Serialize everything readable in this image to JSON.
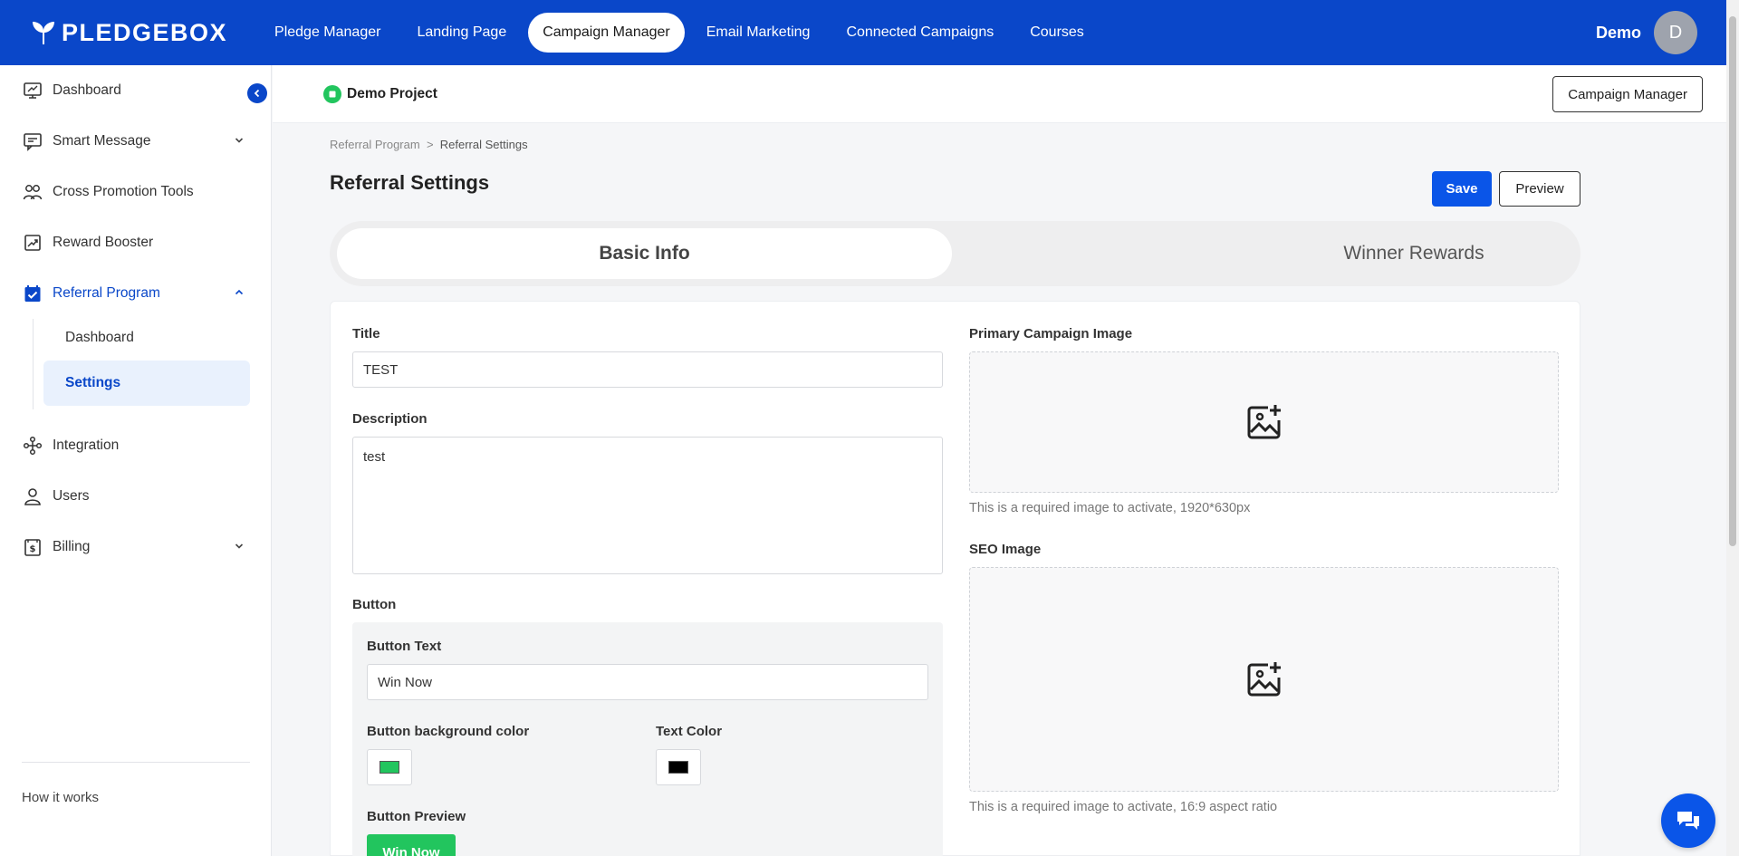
{
  "brand": {
    "name": "PLEDGEBOX"
  },
  "topnav": {
    "items": [
      "Pledge Manager",
      "Landing Page",
      "Campaign Manager",
      "Email Marketing",
      "Connected Campaigns",
      "Courses"
    ],
    "active": "Campaign Manager"
  },
  "user": {
    "name": "Demo",
    "initial": "D"
  },
  "sidebar": {
    "items": [
      {
        "label": "Dashboard",
        "icon": "dashboard-icon"
      },
      {
        "label": "Smart Message",
        "icon": "message-icon"
      },
      {
        "label": "Cross Promotion Tools",
        "icon": "people-icon"
      },
      {
        "label": "Reward Booster",
        "icon": "chart-up-icon"
      },
      {
        "label": "Referral Program",
        "icon": "calendar-check-icon"
      },
      {
        "label": "Integration",
        "icon": "integration-icon"
      },
      {
        "label": "Users",
        "icon": "user-icon"
      },
      {
        "label": "Billing",
        "icon": "billing-icon"
      }
    ],
    "sub_items": [
      "Dashboard",
      "Settings"
    ],
    "footer_link": "How it works"
  },
  "project": {
    "name": "Demo Project",
    "campaign_manager_button": "Campaign Manager"
  },
  "breadcrumb": {
    "parent": "Referral Program",
    "separator": ">",
    "current": "Referral Settings"
  },
  "page": {
    "title": "Referral Settings",
    "save_label": "Save",
    "preview_label": "Preview"
  },
  "tabs": [
    "Basic Info",
    "Winner Rewards"
  ],
  "form": {
    "title_label": "Title",
    "title_value": "TEST",
    "description_label": "Description",
    "description_value": "test",
    "button_section_label": "Button",
    "button_text_label": "Button Text",
    "button_text_value": "Win Now",
    "bg_color_label": "Button background color",
    "bg_color": "#22c55e",
    "text_color_label": "Text Color",
    "text_color": "#000000",
    "button_preview_label": "Button Preview",
    "button_preview_text": "Win Now",
    "primary_image_label": "Primary Campaign Image",
    "primary_image_hint": "This is a required image to activate, 1920*630px",
    "seo_image_label": "SEO Image",
    "seo_image_hint": "This is a required image to activate, 16:9 aspect ratio"
  },
  "colors": {
    "brand_blue": "#0a47c9",
    "save_blue": "#0a55e8",
    "green": "#22c55e"
  }
}
